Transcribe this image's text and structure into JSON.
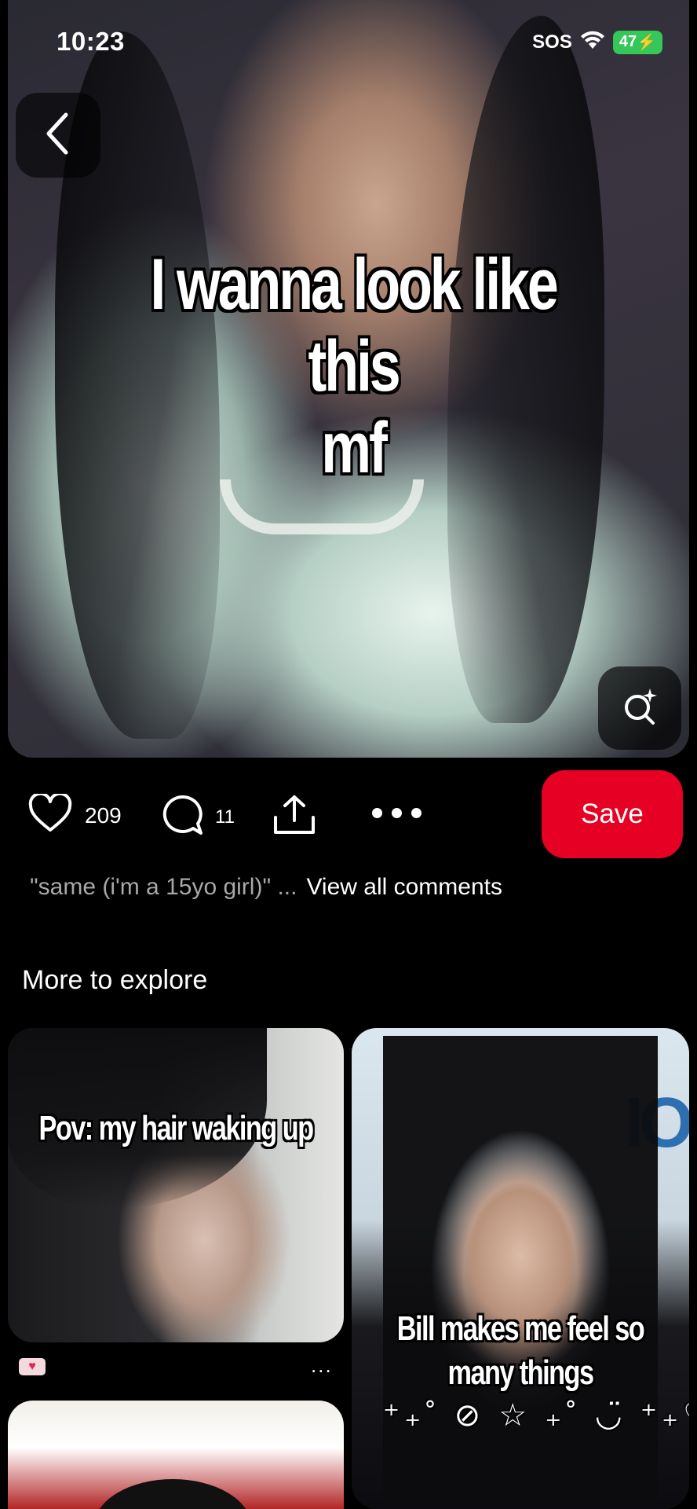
{
  "status_bar": {
    "time": "10:23",
    "sos": "SOS",
    "battery": "47"
  },
  "pin": {
    "caption_line1": "I wanna look like this",
    "caption_line2": "mf"
  },
  "actions": {
    "like_count": "209",
    "comment_count": "11",
    "save_label": "Save"
  },
  "comments": {
    "preview": "\"same (i'm a 15yo girl)\" ...",
    "view_all": "View all comments"
  },
  "explore": {
    "title": "More to explore",
    "cards": [
      {
        "caption": "Pov: my hair waking up"
      },
      {
        "caption_line1": "Bill makes me feel so",
        "caption_line2": "many things",
        "decoration": "⁺₊˚ ⊘ ☆ ₊˚ ◡̈ ⁺₊♡"
      },
      {
        "caption": ""
      }
    ],
    "more_label": "..."
  },
  "colors": {
    "save_button": "#e60023",
    "battery": "#35c759"
  },
  "icons": [
    "back-chevron-icon",
    "visual-search-icon",
    "heart-icon",
    "comment-icon",
    "share-icon",
    "more-icon",
    "wifi-icon"
  ]
}
